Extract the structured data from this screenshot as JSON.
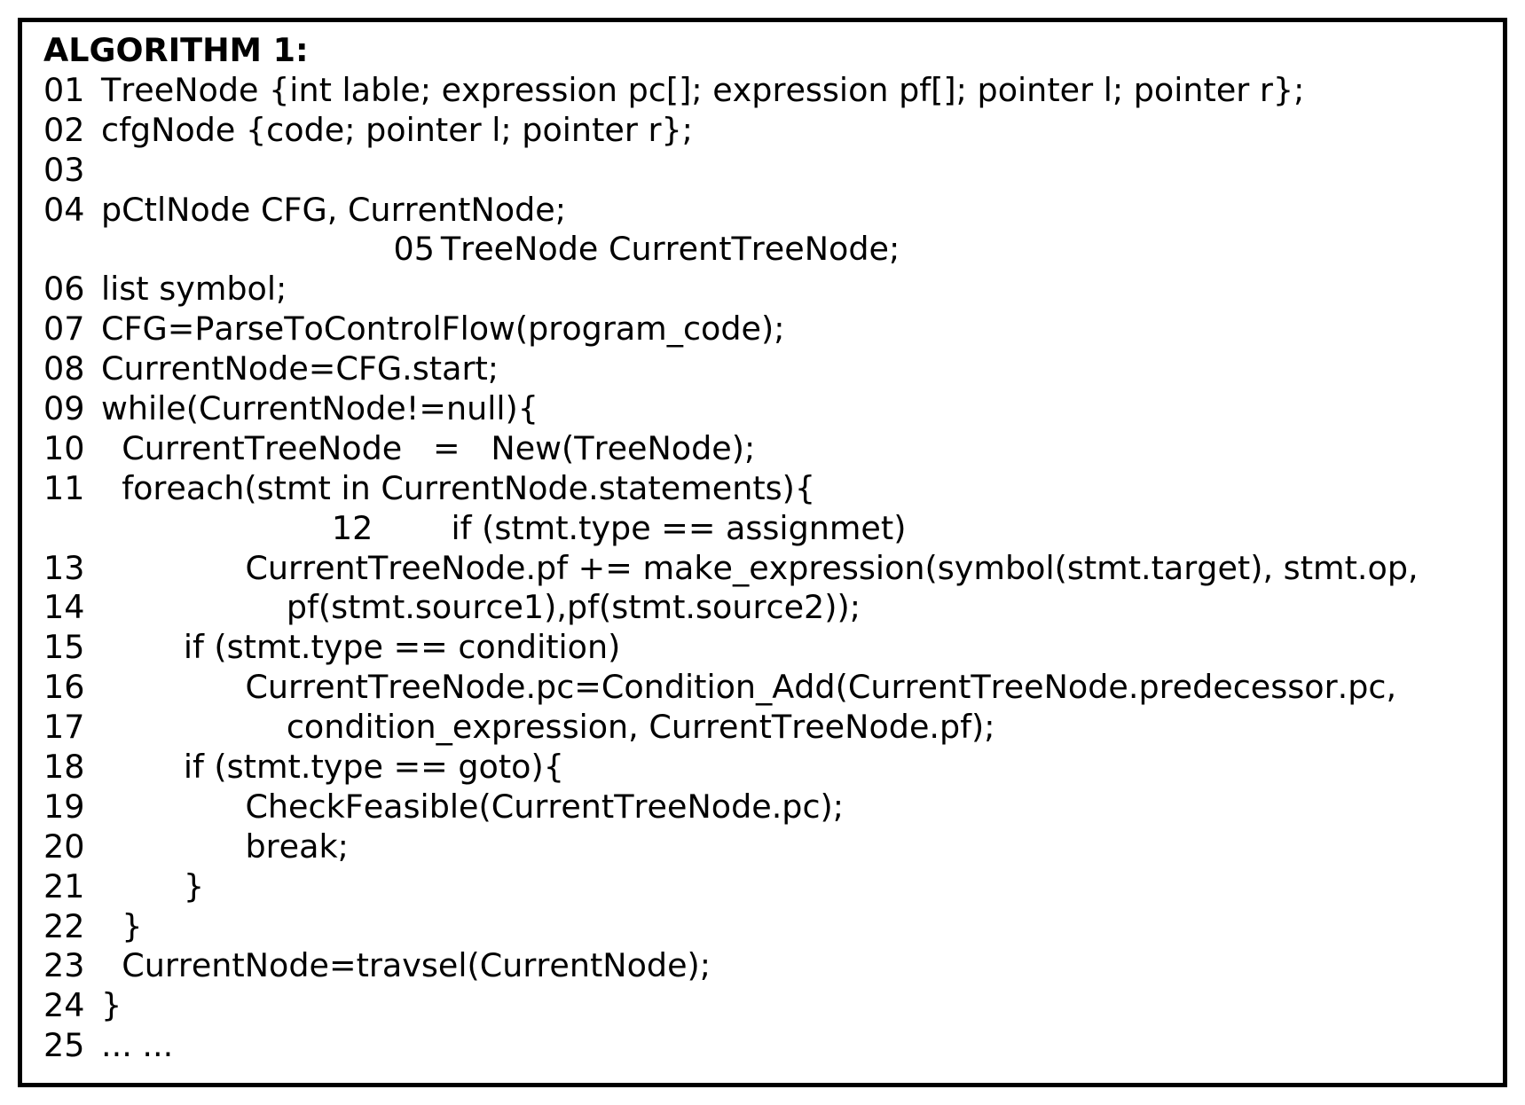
{
  "algorithm": {
    "title": "ALGORITHM 1:",
    "lines": [
      {
        "num": "01",
        "indent": 0,
        "text": "TreeNode {int lable; expression pc[]; expression pf[]; pointer l; pointer r};"
      },
      {
        "num": "02",
        "indent": 0,
        "text": "cfgNode {code; pointer l; pointer r};"
      },
      {
        "num": "03",
        "indent": 0,
        "text": ""
      },
      {
        "num": "04",
        "indent": 0,
        "text": "pCtlNode CFG, CurrentNode;"
      },
      {
        "num": "05",
        "indent": 34,
        "text": "TreeNode CurrentTreeNode;"
      },
      {
        "num": "06",
        "indent": 0,
        "text": "list symbol;"
      },
      {
        "num": "07",
        "indent": 0,
        "text": "CFG=ParseToControlFlow(program_code);"
      },
      {
        "num": "08",
        "indent": 0,
        "text": "CurrentNode=CFG.start;"
      },
      {
        "num": "09",
        "indent": 0,
        "text": "while(CurrentNode!=null){"
      },
      {
        "num": "10",
        "indent": 2,
        "text": "CurrentTreeNode   =   New(TreeNode);"
      },
      {
        "num": "11",
        "indent": 2,
        "text": "foreach(stmt in CurrentNode.statements){"
      },
      {
        "num": "12",
        "indent": 28,
        "text": "       if (stmt.type == assignmet)"
      },
      {
        "num": "13",
        "indent": 14,
        "text": "CurrentTreeNode.pf += make_expression(symbol(stmt.target), stmt.op,"
      },
      {
        "num": "14",
        "indent": 18,
        "text": "pf(stmt.source1),pf(stmt.source2));"
      },
      {
        "num": "15",
        "indent": 8,
        "text": "if (stmt.type == condition)"
      },
      {
        "num": "16",
        "indent": 14,
        "text": "CurrentTreeNode.pc=Condition_Add(CurrentTreeNode.predecessor.pc,"
      },
      {
        "num": "17",
        "indent": 18,
        "text": "condition_expression, CurrentTreeNode.pf);"
      },
      {
        "num": "18",
        "indent": 8,
        "text": "if (stmt.type == goto){"
      },
      {
        "num": "19",
        "indent": 14,
        "text": "CheckFeasible(CurrentTreeNode.pc);"
      },
      {
        "num": "20",
        "indent": 14,
        "text": "break;"
      },
      {
        "num": "21",
        "indent": 8,
        "text": "}"
      },
      {
        "num": "22",
        "indent": 2,
        "text": "}"
      },
      {
        "num": "23",
        "indent": 2,
        "text": "CurrentNode=travsel(CurrentNode);"
      },
      {
        "num": "24",
        "indent": 0,
        "text": "}"
      },
      {
        "num": "25",
        "indent": 0,
        "text": "... ..."
      }
    ]
  }
}
